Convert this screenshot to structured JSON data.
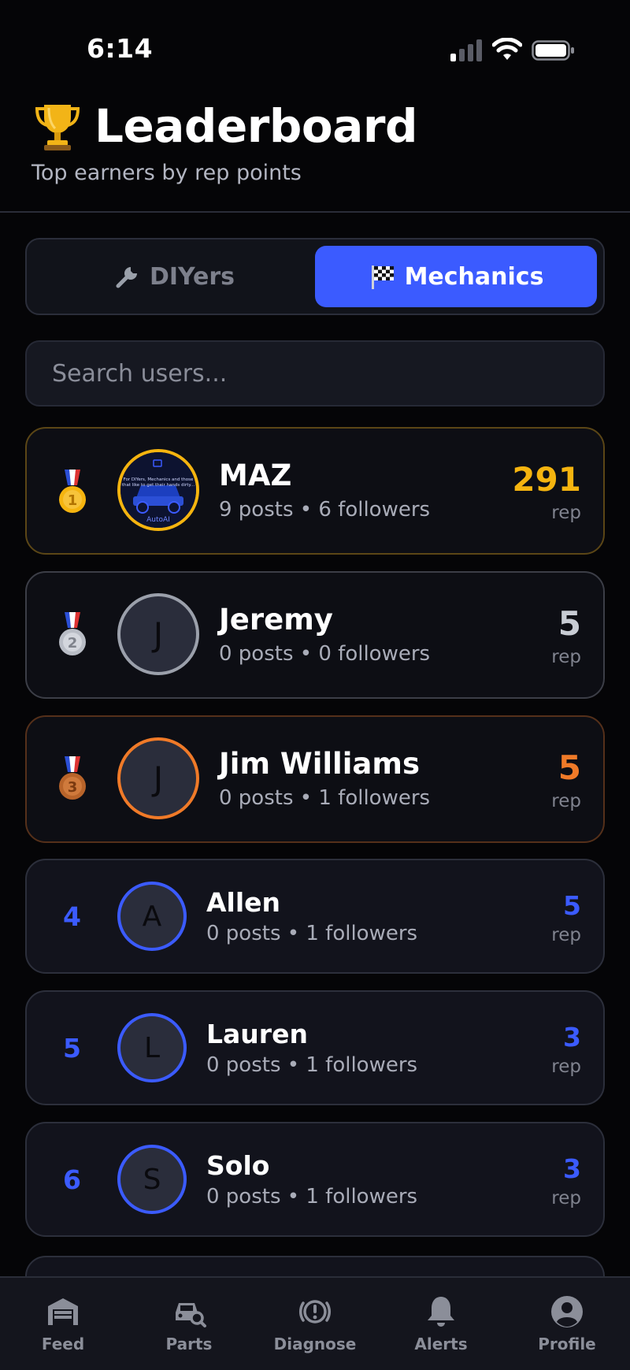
{
  "status_bar": {
    "time": "6:14"
  },
  "header": {
    "emoji": "🏆",
    "title": "Leaderboard",
    "subtitle": "Top earners by rep points"
  },
  "tabs": [
    {
      "icon": "wrench-icon",
      "label": "DIYers",
      "active": false
    },
    {
      "icon": "checkered-flag-icon",
      "label": "Mechanics",
      "active": true
    }
  ],
  "search": {
    "placeholder": "Search users..."
  },
  "leaderboard": [
    {
      "rank": "1",
      "medal": "gold",
      "name": "MAZ",
      "meta": "9 posts • 6 followers",
      "rep": "291",
      "rep_label": "rep",
      "avatar_letter": "",
      "avatar_image_text": [
        "For DIYers, Mechanics and those",
        "that like to get their hands dirty...",
        "AutoAI"
      ]
    },
    {
      "rank": "2",
      "medal": "silver",
      "name": "Jeremy",
      "meta": "0 posts • 0 followers",
      "rep": "5",
      "rep_label": "rep",
      "avatar_letter": "J"
    },
    {
      "rank": "3",
      "medal": "bronze",
      "name": "Jim Williams",
      "meta": "0 posts • 1 followers",
      "rep": "5",
      "rep_label": "rep",
      "avatar_letter": "J"
    },
    {
      "rank": "4",
      "name": "Allen",
      "meta": "0 posts • 1 followers",
      "rep": "5",
      "rep_label": "rep",
      "avatar_letter": "A"
    },
    {
      "rank": "5",
      "name": "Lauren",
      "meta": "0 posts • 1 followers",
      "rep": "3",
      "rep_label": "rep",
      "avatar_letter": "L"
    },
    {
      "rank": "6",
      "name": "Solo",
      "meta": "0 posts • 1 followers",
      "rep": "3",
      "rep_label": "rep",
      "avatar_letter": "S"
    }
  ],
  "bottom_nav": [
    {
      "icon": "garage-icon",
      "label": "Feed"
    },
    {
      "icon": "car-search-icon",
      "label": "Parts"
    },
    {
      "icon": "warning-circle-icon",
      "label": "Diagnose"
    },
    {
      "icon": "bell-icon",
      "label": "Alerts"
    },
    {
      "icon": "user-circle-icon",
      "label": "Profile"
    }
  ],
  "colors": {
    "accent": "#3b5bff",
    "gold": "#f5b40f",
    "silver": "#c8ccd4",
    "bronze": "#f07a28",
    "background": "#050507"
  }
}
